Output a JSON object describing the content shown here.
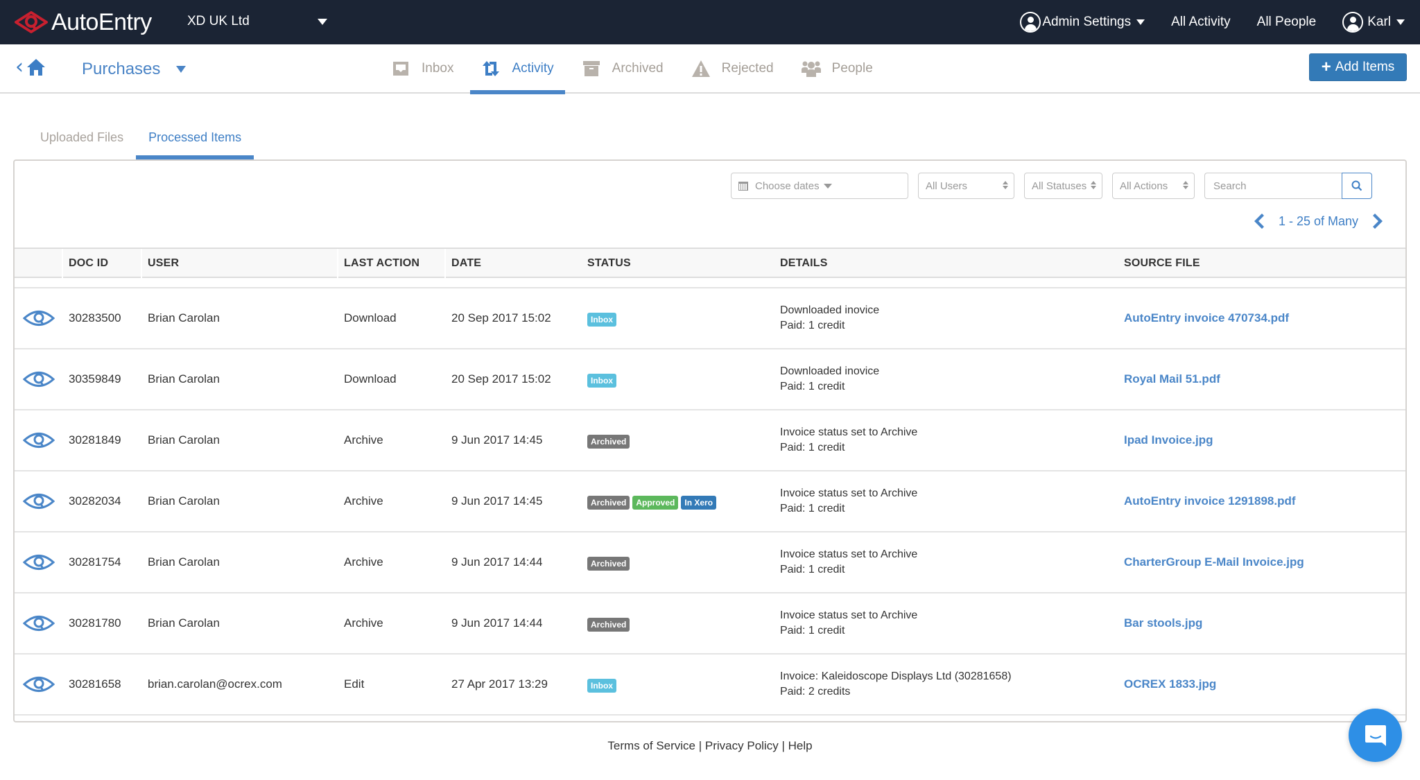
{
  "topbar": {
    "brand": "AutoEntry",
    "organization": "XD UK Ltd",
    "admin_settings": "Admin Settings",
    "all_activity": "All Activity",
    "all_people": "All People",
    "user_name": "Karl"
  },
  "subnav": {
    "section": "Purchases",
    "tabs": [
      {
        "label": "Inbox",
        "icon": "inbox-icon"
      },
      {
        "label": "Activity",
        "icon": "activity-icon",
        "active": true
      },
      {
        "label": "Archived",
        "icon": "archive-box-icon"
      },
      {
        "label": "Rejected",
        "icon": "warning-icon"
      },
      {
        "label": "People",
        "icon": "people-icon"
      }
    ],
    "add_items": "Add Items"
  },
  "inner_tabs": [
    {
      "label": "Uploaded Files"
    },
    {
      "label": "Processed Items",
      "active": true
    }
  ],
  "filters": {
    "dates": "Choose dates",
    "users": "All Users",
    "statuses": "All Statuses",
    "actions": "All Actions",
    "search_placeholder": "Search"
  },
  "pagination": {
    "label": "1 - 25 of Many"
  },
  "table": {
    "columns": [
      "DOC ID",
      "USER",
      "LAST ACTION",
      "DATE",
      "STATUS",
      "DETAILS",
      "SOURCE FILE"
    ],
    "rows": [
      {
        "doc_id": "30283500",
        "user": "Brian Carolan",
        "action": "Download",
        "date": "20 Sep 2017 15:02",
        "statuses": [
          "Inbox"
        ],
        "details": [
          "Downloaded inovice",
          "Paid: 1 credit"
        ],
        "source": "AutoEntry invoice 470734.pdf"
      },
      {
        "doc_id": "30359849",
        "user": "Brian Carolan",
        "action": "Download",
        "date": "20 Sep 2017 15:02",
        "statuses": [
          "Inbox"
        ],
        "details": [
          "Downloaded inovice",
          "Paid: 1 credit"
        ],
        "source": "Royal Mail 51.pdf"
      },
      {
        "doc_id": "30281849",
        "user": "Brian Carolan",
        "action": "Archive",
        "date": "9 Jun 2017 14:45",
        "statuses": [
          "Archived"
        ],
        "details": [
          "Invoice status set to Archive",
          "Paid: 1 credit"
        ],
        "source": "Ipad Invoice.jpg"
      },
      {
        "doc_id": "30282034",
        "user": "Brian Carolan",
        "action": "Archive",
        "date": "9 Jun 2017 14:45",
        "statuses": [
          "Archived",
          "Approved",
          "In Xero"
        ],
        "details": [
          "Invoice status set to Archive",
          "Paid: 1 credit"
        ],
        "source": "AutoEntry invoice 1291898.pdf"
      },
      {
        "doc_id": "30281754",
        "user": "Brian Carolan",
        "action": "Archive",
        "date": "9 Jun 2017 14:44",
        "statuses": [
          "Archived"
        ],
        "details": [
          "Invoice status set to Archive",
          "Paid: 1 credit"
        ],
        "source": "CharterGroup E-Mail Invoice.jpg"
      },
      {
        "doc_id": "30281780",
        "user": "Brian Carolan",
        "action": "Archive",
        "date": "9 Jun 2017 14:44",
        "statuses": [
          "Archived"
        ],
        "details": [
          "Invoice status set to Archive",
          "Paid: 1 credit"
        ],
        "source": "Bar stools.jpg"
      },
      {
        "doc_id": "30281658",
        "user": "brian.carolan@ocrex.com",
        "action": "Edit",
        "date": "27 Apr 2017 13:29",
        "statuses": [
          "Inbox"
        ],
        "details": [
          "Invoice: Kaleidoscope Displays Ltd (30281658)",
          "Paid: 2 credits"
        ],
        "source": "OCREX 1833.jpg"
      }
    ]
  },
  "footer": {
    "terms": "Terms of Service",
    "privacy": "Privacy Policy",
    "help": "Help",
    "separator": "|"
  },
  "colors": {
    "topbar_bg": "#1b2434",
    "accent": "#4a86c8",
    "primary_button": "#337ab7",
    "badge_inbox": "#5bc0de",
    "badge_archived": "#777777",
    "badge_approved": "#5cb85c",
    "badge_xero": "#337ab7",
    "chat_button": "#2e8fe6",
    "logo_red": "#c8202f"
  }
}
